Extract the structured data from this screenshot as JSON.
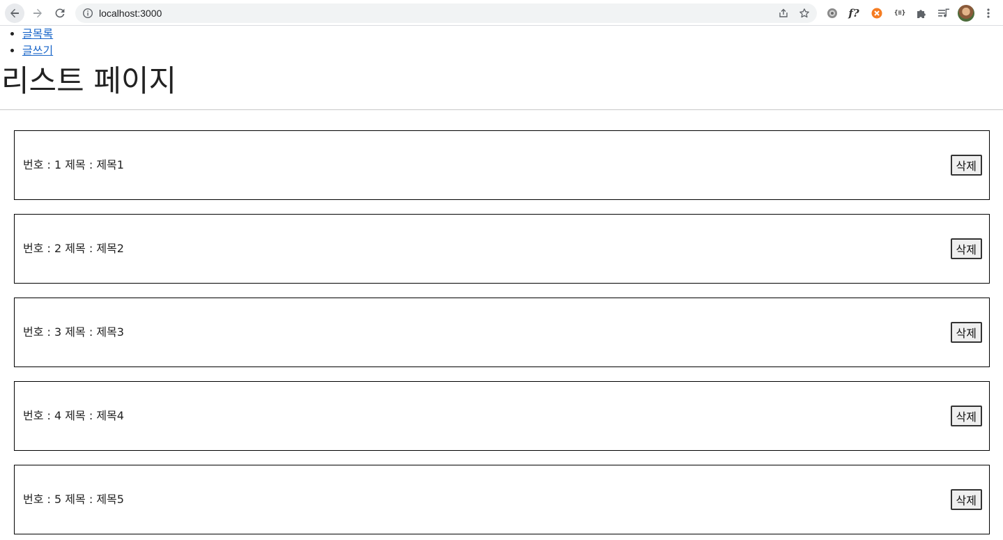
{
  "browser": {
    "url": "localhost:3000"
  },
  "nav": {
    "links": [
      {
        "label": "글목록"
      },
      {
        "label": "글쓰기"
      }
    ]
  },
  "page": {
    "title": "리스트 페이지"
  },
  "posts": [
    {
      "number_label": "번호 :",
      "number": "1",
      "title_label": "제목 :",
      "title": "제목1",
      "delete_label": "삭제"
    },
    {
      "number_label": "번호 :",
      "number": "2",
      "title_label": "제목 :",
      "title": "제목2",
      "delete_label": "삭제"
    },
    {
      "number_label": "번호 :",
      "number": "3",
      "title_label": "제목 :",
      "title": "제목3",
      "delete_label": "삭제"
    },
    {
      "number_label": "번호 :",
      "number": "4",
      "title_label": "제목 :",
      "title": "제목4",
      "delete_label": "삭제"
    },
    {
      "number_label": "번호 :",
      "number": "5",
      "title_label": "제목 :",
      "title": "제목5",
      "delete_label": "삭제"
    }
  ],
  "extensions": {
    "fq_label": "f?",
    "json_label": "{≡}"
  },
  "icons": [
    "back-icon",
    "forward-icon",
    "reload-icon",
    "info-icon",
    "share-icon",
    "star-icon",
    "settings-icon",
    "orange-extension-icon",
    "puzzle-icon",
    "media-icon",
    "avatar",
    "more-menu-icon"
  ],
  "colors": {
    "link": "#1a66c9",
    "omnibox_bg": "#f1f3f4"
  }
}
